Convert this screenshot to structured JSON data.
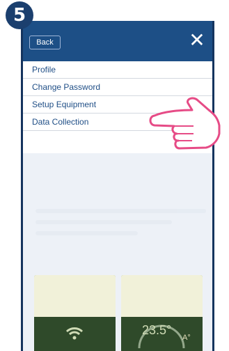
{
  "step": "5",
  "header": {
    "back_label": "Back",
    "close_label": "✕"
  },
  "menu": {
    "items": [
      {
        "label": "Profile"
      },
      {
        "label": "Change Password"
      },
      {
        "label": "Setup Equipment"
      },
      {
        "label": "Data Collection"
      }
    ]
  },
  "tiles": {
    "temperature": "23.5°",
    "unit": "A°"
  },
  "colors": {
    "header": "#1d4f86",
    "menu_text": "#1f4e86",
    "hand_stroke": "#e64b86"
  }
}
